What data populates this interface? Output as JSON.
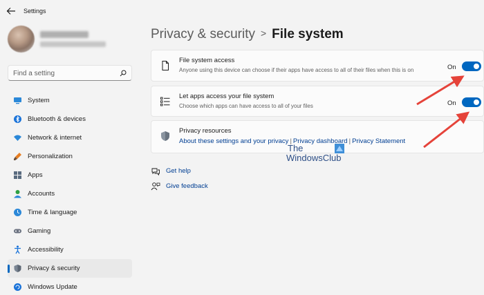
{
  "window": {
    "title": "Settings"
  },
  "search": {
    "placeholder": "Find a setting"
  },
  "sidebar": {
    "items": [
      {
        "label": "System",
        "icon": "system-icon"
      },
      {
        "label": "Bluetooth & devices",
        "icon": "bluetooth-icon"
      },
      {
        "label": "Network & internet",
        "icon": "network-icon"
      },
      {
        "label": "Personalization",
        "icon": "brush-icon"
      },
      {
        "label": "Apps",
        "icon": "apps-icon"
      },
      {
        "label": "Accounts",
        "icon": "accounts-icon"
      },
      {
        "label": "Time & language",
        "icon": "time-language-icon"
      },
      {
        "label": "Gaming",
        "icon": "gaming-icon"
      },
      {
        "label": "Accessibility",
        "icon": "accessibility-icon"
      },
      {
        "label": "Privacy & security",
        "icon": "shield-icon",
        "active": true
      },
      {
        "label": "Windows Update",
        "icon": "windows-update-icon"
      }
    ]
  },
  "breadcrumb": {
    "parent": "Privacy & security",
    "separator": ">",
    "current": "File system"
  },
  "settings": {
    "file_system_access": {
      "title": "File system access",
      "description": "Anyone using this device can choose if their apps have access to all of their files when this is on",
      "state_label": "On",
      "enabled": true
    },
    "apps_access": {
      "title": "Let apps access your file system",
      "description": "Choose which apps can have access to all of your files",
      "state_label": "On",
      "enabled": true
    }
  },
  "privacy_resources": {
    "title": "Privacy resources",
    "links": {
      "about": "About these settings and your privacy",
      "dashboard": "Privacy dashboard",
      "statement": "Privacy Statement"
    },
    "separator": "|"
  },
  "help": {
    "get_help": "Get help",
    "give_feedback": "Give feedback"
  },
  "watermark": {
    "line1": "The",
    "line2": "WindowsClub"
  },
  "colors": {
    "accent": "#0067c0",
    "link": "#003e92",
    "background": "#f3f3f3",
    "card": "#fbfbfb",
    "annotation_arrow": "#e5433a"
  }
}
